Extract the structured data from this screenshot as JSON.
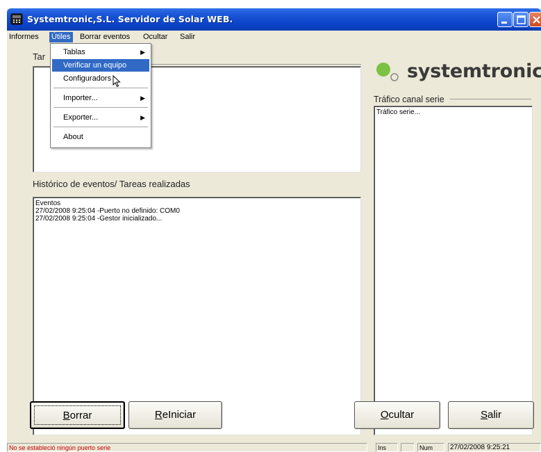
{
  "window": {
    "title": "Systemtronic,S.L. Servidor de Solar WEB."
  },
  "menubar": {
    "items": [
      "Informes",
      "Útiles",
      "Borrar eventos",
      "Ocultar",
      "Salir"
    ]
  },
  "dropdown": {
    "items": [
      {
        "label": "Tablas",
        "submenu": true
      },
      {
        "label": "Verificar un equipo",
        "highlighted": true
      },
      {
        "label": "Configuradors"
      },
      {
        "label": "Importer...",
        "submenu": true
      },
      {
        "label": "Exporter...",
        "submenu": true
      },
      {
        "label": "About"
      }
    ]
  },
  "top_group": {
    "label": "Tar"
  },
  "history": {
    "label": "Histórico de eventos/ Tareas realizadas",
    "lines": [
      "Eventos",
      "27/02/2008 9:25:04 -Puerto no definido: COM0",
      "27/02/2008 9:25:04 -Gestor inicializado..."
    ]
  },
  "logo": {
    "text": "systemtronic",
    "dot_color": "#7cc242"
  },
  "serial": {
    "label": "Tráfico canal serie",
    "content": "Tráfico serie..."
  },
  "buttons": {
    "borrar": {
      "text": "Borrar",
      "accel": "B"
    },
    "reiniciar": {
      "text": "ReIniciar",
      "accel": "R"
    },
    "ocultar": {
      "text": "Ocultar",
      "accel": "O"
    },
    "salir": {
      "text": "Salir",
      "accel": "S"
    }
  },
  "statusbar": {
    "message": "No se estableció ningún puerto serie",
    "ins": "Ins",
    "num": "Num",
    "datetime": "27/02/2008 9:25:21",
    "message_color": "#c00000"
  }
}
